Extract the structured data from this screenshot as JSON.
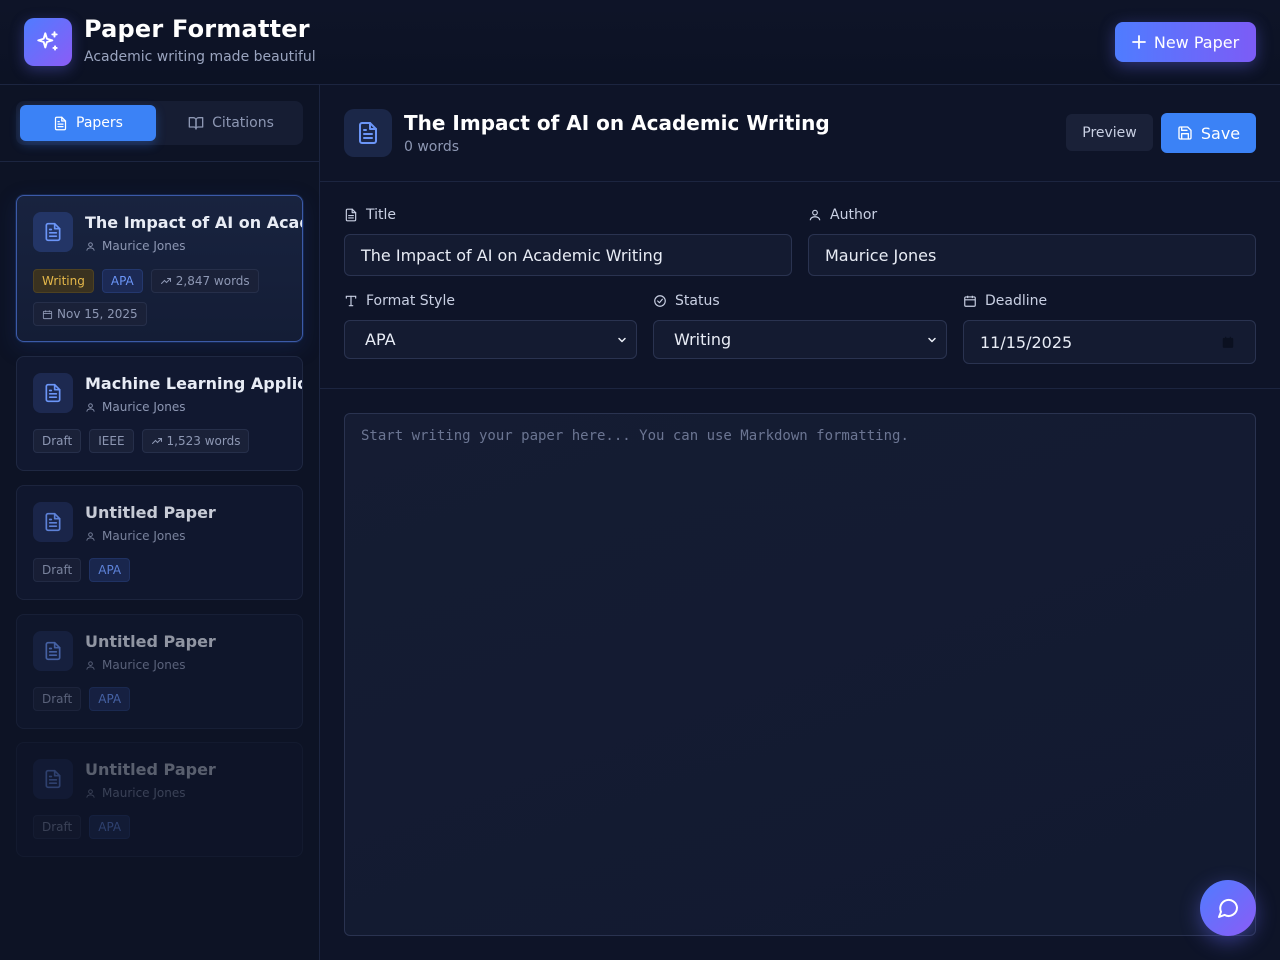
{
  "app": {
    "title": "Paper Formatter",
    "subtitle": "Academic writing made beautiful",
    "new_paper_label": "New Paper",
    "accent": "#3b82f6",
    "gradient": [
      "#4f7cff",
      "#8b5cf6"
    ]
  },
  "sidebar": {
    "tabs": [
      {
        "label": "Papers",
        "icon": "file-text-icon",
        "active": true
      },
      {
        "label": "Citations",
        "icon": "book-open-icon",
        "active": false
      }
    ],
    "papers": [
      {
        "title": "The Impact of AI on Academic Writing",
        "author": "Maurice Jones",
        "status": "Writing",
        "format": "APA",
        "words": "2,847 words",
        "date": "Nov 15, 2025",
        "active": true
      },
      {
        "title": "Machine Learning Applications",
        "author": "Maurice Jones",
        "status": "Draft",
        "format": "IEEE",
        "words": "1,523 words"
      },
      {
        "title": "Untitled Paper",
        "author": "Maurice Jones",
        "status": "Draft",
        "format": "APA"
      },
      {
        "title": "Untitled Paper",
        "author": "Maurice Jones",
        "status": "Draft",
        "format": "APA"
      },
      {
        "title": "Untitled Paper",
        "author": "Maurice Jones",
        "status": "Draft",
        "format": "APA"
      }
    ]
  },
  "editor": {
    "title": "The Impact of AI on Academic Writing",
    "word_count": "0 words",
    "preview_label": "Preview",
    "save_label": "Save",
    "fields": {
      "title_label": "Title",
      "title_value": "The Impact of AI on Academic Writing",
      "author_label": "Author",
      "author_value": "Maurice Jones",
      "format_label": "Format Style",
      "format_value": "APA",
      "status_label": "Status",
      "status_value": "Writing",
      "deadline_label": "Deadline",
      "deadline_value": "11/15/2025"
    },
    "body_placeholder": "Start writing your paper here... You can use Markdown formatting."
  }
}
